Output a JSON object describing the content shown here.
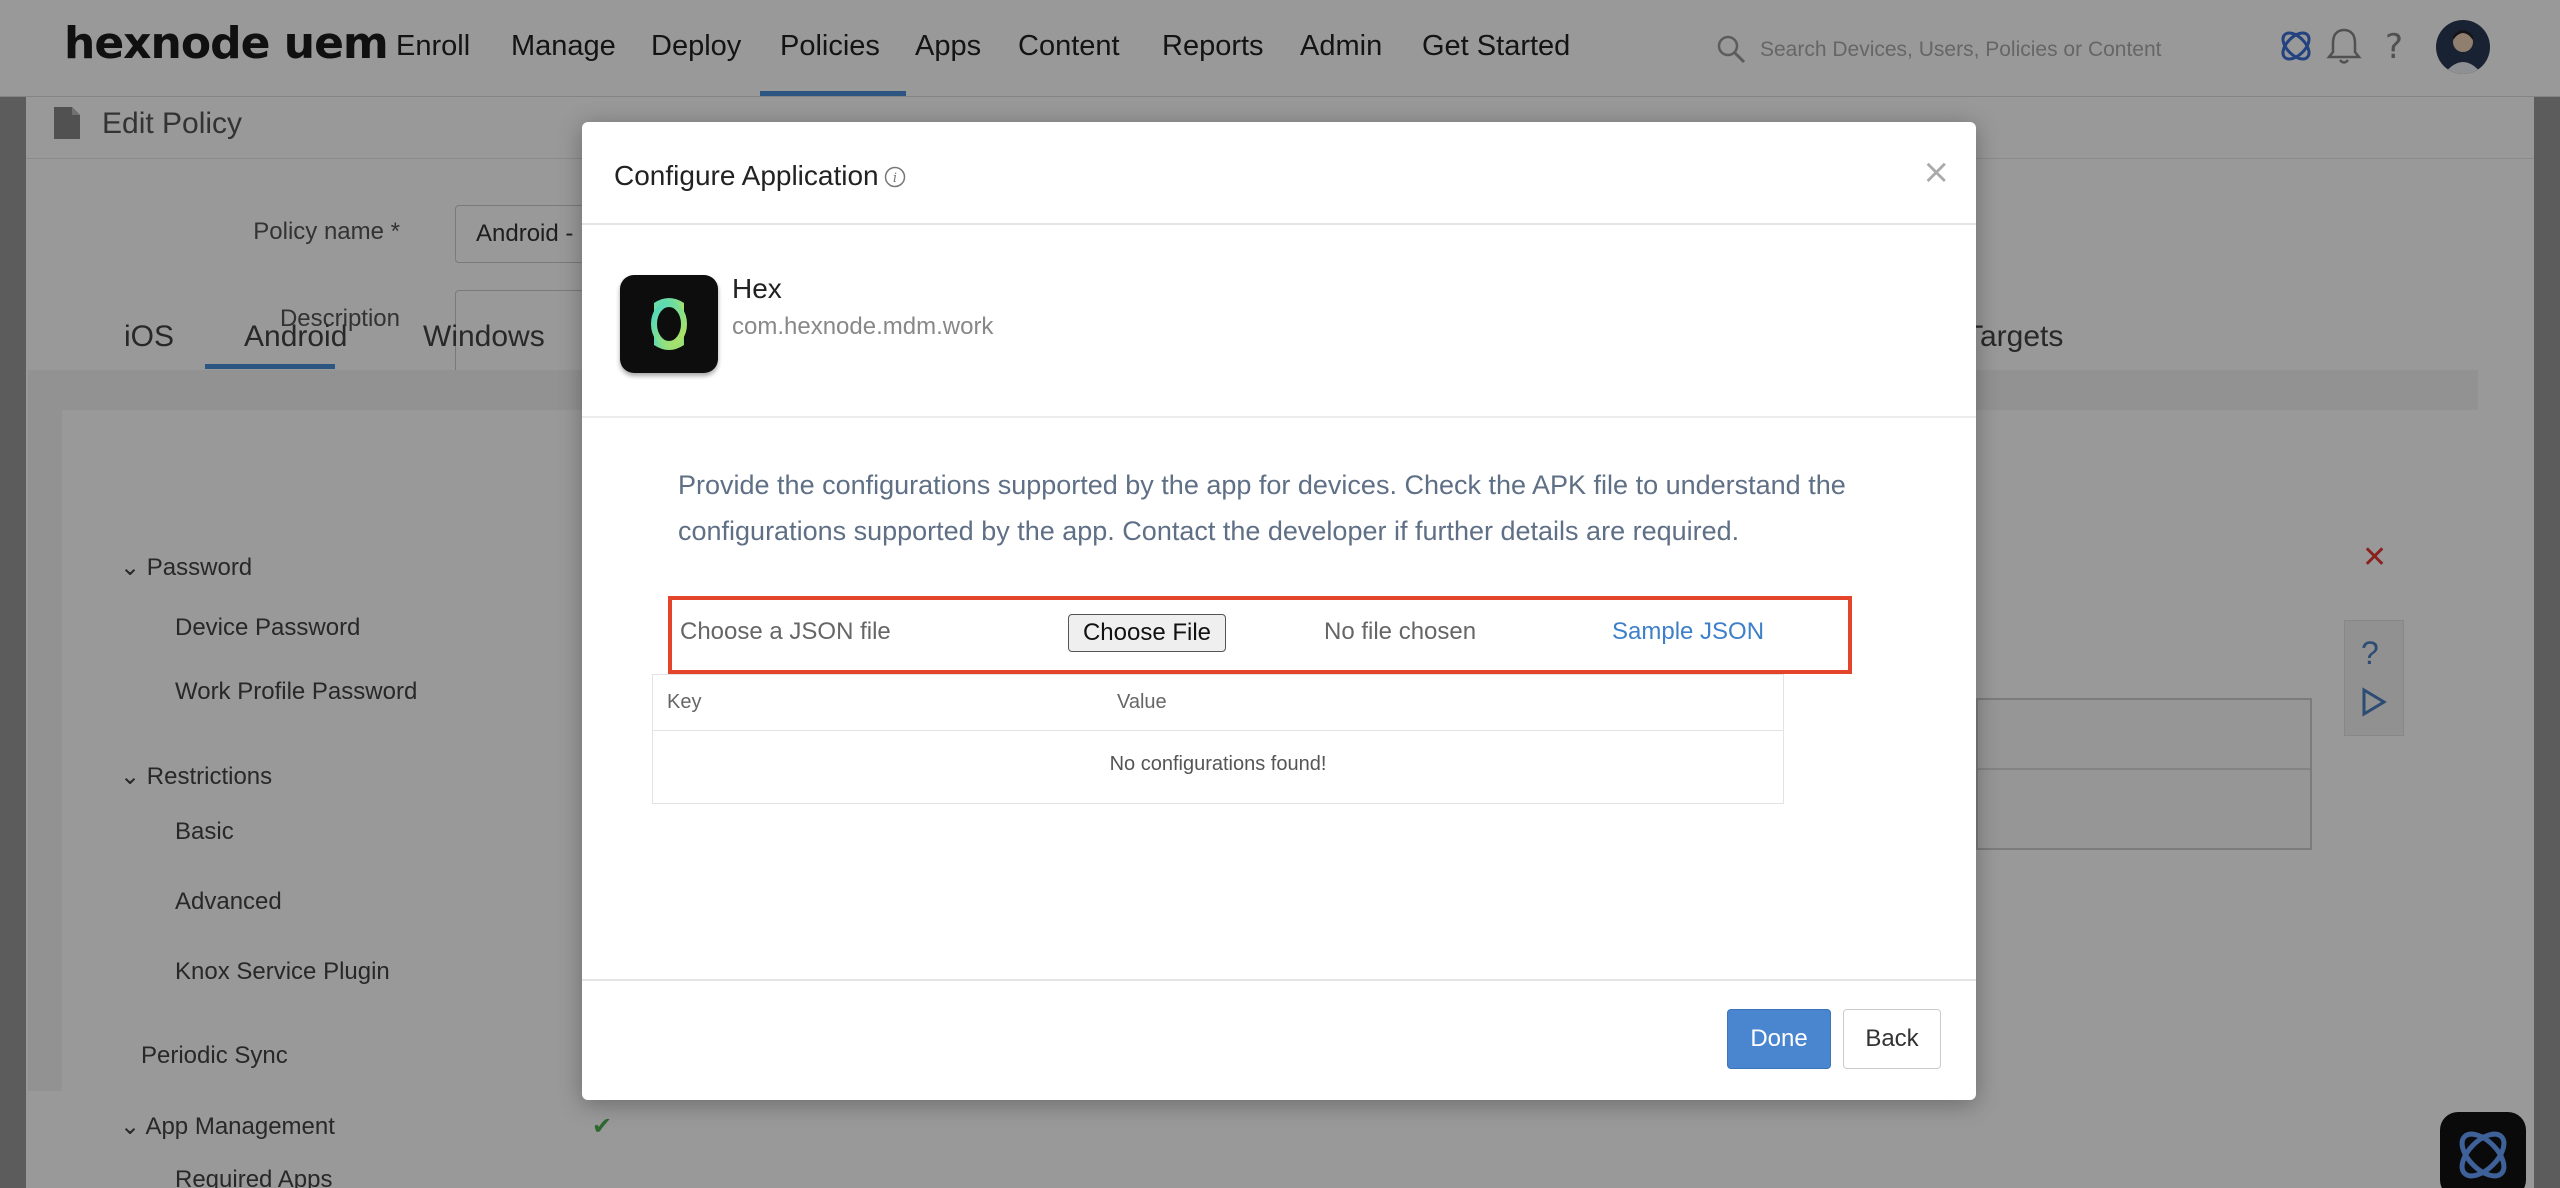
{
  "brand": {
    "logo_text": "hexnode uem"
  },
  "nav": {
    "items": [
      "Enroll",
      "Manage",
      "Deploy",
      "Policies",
      "Apps",
      "Content",
      "Reports",
      "Admin",
      "Get Started"
    ],
    "active": "Policies",
    "search_placeholder": "Search Devices, Users, Policies or Content"
  },
  "page": {
    "title": "Edit Policy",
    "policy_name_label": "Policy name *",
    "policy_name_value": "Android - ",
    "description_label": "Description",
    "platform_tabs": [
      "iOS",
      "Android",
      "Windows"
    ],
    "active_platform": "Android",
    "targets_label": "Targets",
    "sidebar": {
      "password_group": "Password",
      "password_items": [
        "Device Password",
        "Work Profile Password"
      ],
      "restrictions_group": "Restrictions",
      "restrictions_items": [
        "Basic",
        "Advanced",
        "Knox Service Plugin"
      ],
      "periodic_sync": "Periodic Sync",
      "app_management_group": "App Management",
      "app_management_items": [
        "Required Apps"
      ]
    },
    "help_glyph": "?"
  },
  "modal": {
    "title": "Configure Application",
    "app": {
      "name": "Hex",
      "package": "com.hexnode.mdm.work"
    },
    "description": "Provide the configurations supported by the app for devices. Check the APK file to understand the configurations supported by the app. Contact the developer if further details are required.",
    "json_label": "Choose a JSON file",
    "choose_file_label": "Choose File",
    "no_file_label": "No file chosen",
    "sample_json_label": "Sample JSON",
    "table": {
      "columns": [
        "Key",
        "Value"
      ],
      "empty_message": "No configurations found!"
    },
    "done_label": "Done",
    "back_label": "Back",
    "close_glyph": "×"
  },
  "colors": {
    "accent": "#4a86cf",
    "highlight": "#e2452c",
    "link": "#3d7fc9",
    "success": "#4caf50"
  }
}
